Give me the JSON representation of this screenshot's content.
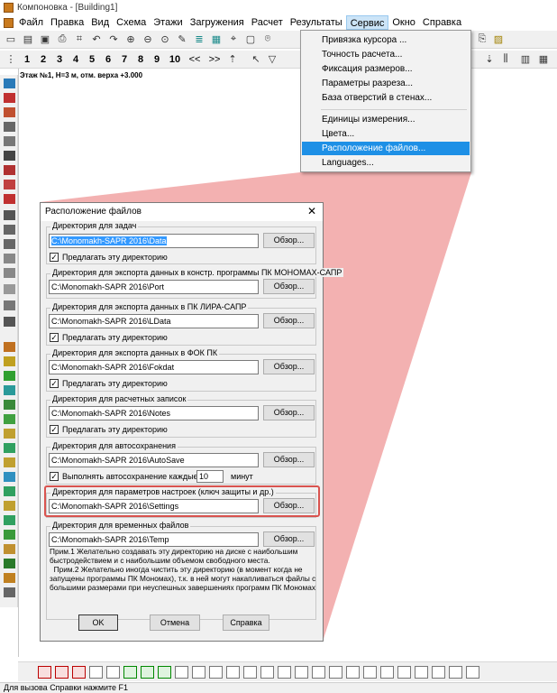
{
  "window": {
    "title": "Компоновка - [Building1]"
  },
  "menubar": [
    "Файл",
    "Правка",
    "Вид",
    "Схема",
    "Этажи",
    "Загружения",
    "Расчет",
    "Результаты",
    "Сервис",
    "Окно",
    "Справка"
  ],
  "floor_toolbar": {
    "numbers": [
      "1",
      "2",
      "3",
      "4",
      "5",
      "6",
      "7",
      "8",
      "9",
      "10"
    ],
    "prev": "<<",
    "next": ">>"
  },
  "floor_info": "Этаж №1, Н=3 м, отм. верха +3.000",
  "service_menu": {
    "items": [
      "Привязка курсора ...",
      "Точность расчета...",
      "Фиксация размеров...",
      "Параметры разреза...",
      "База отверстий в стенах...",
      "Единицы измерения...",
      "Цвета...",
      "Расположение файлов...",
      "Languages..."
    ],
    "highlighted": "Расположение файлов..."
  },
  "dialog": {
    "title": "Расположение файлов",
    "close": "✕",
    "browse_label": "Обзор...",
    "checkbox_label": "Предлагать эту директорию",
    "groups": [
      {
        "label": "Директория для задач",
        "path": "C:\\Monomakh-SAPR 2016\\Data",
        "checkbox": true
      },
      {
        "label": "Директория для экспорта данных в констр. программы ПК МОНОМАХ-САПР",
        "path": "C:\\Monomakh-SAPR 2016\\Port",
        "checkbox": false
      },
      {
        "label": "Директория для экспорта данных в ПК ЛИРА-САПР",
        "path": "C:\\Monomakh-SAPR 2016\\LData",
        "checkbox": true
      },
      {
        "label": "Директория для экспорта данных в ФОК ПК",
        "path": "C:\\Monomakh-SAPR 2016\\Fokdat",
        "checkbox": true
      },
      {
        "label": "Директория для расчетных записок",
        "path": "C:\\Monomakh-SAPR 2016\\Notes",
        "checkbox": true
      },
      {
        "label": "Директория для автосохранения",
        "path": "C:\\Monomakh-SAPR 2016\\AutoSave",
        "checkbox": false
      },
      {
        "label": "Директория для параметров настроек (ключ защиты и др.)",
        "path": "C:\\Monomakh-SAPR 2016\\Settings",
        "checkbox": false
      },
      {
        "label": "Директория для временных файлов",
        "path": "C:\\Monomakh-SAPR 2016\\Temp",
        "checkbox": false
      }
    ],
    "autosave": {
      "label": "Выполнять автосохранение каждые",
      "value": "10",
      "unit": "минут"
    },
    "note": "Прим.1 Желательно создавать эту директорию на диске с наибольшим быстродействием и с наибольшим объемом свободного места.\n  Прим.2 Желательно иногда чистить эту директорию (в момент когда не запущены программы ПК Мономах), т.к. в ней могут накапливаться файлы с большими размерами при неуспешных завершениях программ ПК Мономах",
    "buttons": {
      "ok": "OK",
      "cancel": "Отмена",
      "help": "Справка"
    }
  },
  "status": "Для вызова Справки нажмите F1",
  "colors": {
    "highlight": "#1e90e6",
    "callout": "#f2a8a8",
    "callout_border": "#d9534f"
  }
}
